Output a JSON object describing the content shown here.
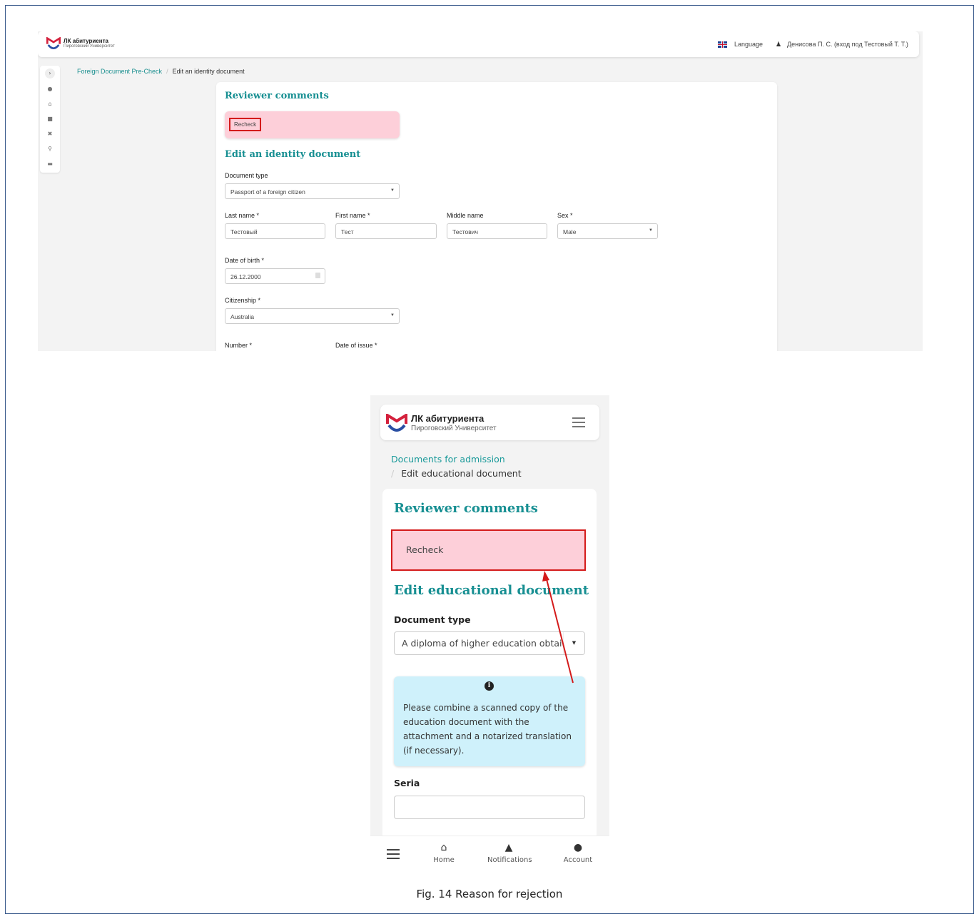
{
  "desktop": {
    "logo": {
      "title": "ЛК абитуриента",
      "subtitle": "Пироговский Университет"
    },
    "language_label": "Language",
    "user_label": "Денисова П. С. (вход под Тестовый Т. Т.)",
    "breadcrumb": {
      "link": "Foreign Document Pre-Check",
      "separator": "/",
      "current": "Edit an identity document"
    },
    "reviewer_heading": "Reviewer comments",
    "reviewer_comment": "Recheck",
    "form_heading": "Edit an identity document",
    "document_type_label": "Document type",
    "document_type_value": "Passport of a foreign citizen",
    "last_name_label": "Last name *",
    "last_name_value": "Тестовый",
    "first_name_label": "First name *",
    "first_name_value": "Тест",
    "middle_name_label": "Middle name",
    "middle_name_value": "Тестович",
    "sex_label": "Sex *",
    "sex_value": "Male",
    "dob_label": "Date of birth *",
    "dob_value": "26.12.2000",
    "citizenship_label": "Citizenship *",
    "citizenship_value": "Australia",
    "number_label": "Number *",
    "date_of_issue_label": "Date of issue *",
    "sidebar_icons": [
      "chevron-right-icon",
      "user-icon",
      "home-icon",
      "handshake-icon",
      "tools-icon",
      "search-icon",
      "folder-icon"
    ]
  },
  "mobile": {
    "logo": {
      "title": "ЛК абитуриента",
      "subtitle": "Пироговский Университет"
    },
    "breadcrumb": {
      "link": "Documents for admission",
      "separator": "/",
      "current": "Edit educational document"
    },
    "reviewer_heading": "Reviewer comments",
    "reviewer_comment": "Recheck",
    "form_heading": "Edit educational document",
    "document_type_label": "Document type",
    "document_type_value": "A diploma of higher education obtai...",
    "info_text": "Please combine a scanned copy of the education document with the attachment and a notarized translation (if necessary).",
    "seria_label": "Seria",
    "bottom_nav": [
      {
        "label": "Home",
        "icon": "home-icon"
      },
      {
        "label": "Notifications",
        "icon": "bell-icon"
      },
      {
        "label": "Account",
        "icon": "user-icon"
      }
    ]
  },
  "caption": "Fig. 14 Reason for rejection",
  "colors": {
    "accent": "#178f92",
    "link": "#1a9a9a",
    "highlight_border": "#d41b1b",
    "comment_bg": "#fdcfd9",
    "info_bg": "#cff1fb",
    "logo_red": "#d4213d",
    "logo_blue": "#2a4fa3"
  }
}
